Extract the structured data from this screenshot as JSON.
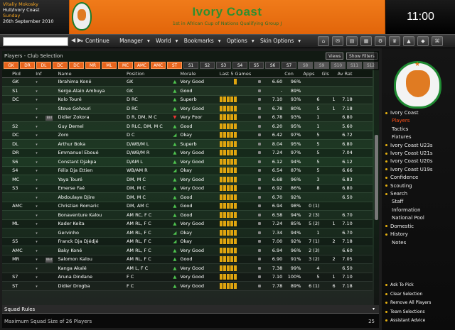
{
  "manager": {
    "name": "Vitaliy Mokosky",
    "club_line": "Hull/Ivory Coast",
    "day": "Sunday",
    "date": "26th September 2010"
  },
  "banner": {
    "title": "Ivory Coast",
    "subtitle": "1st in African Cup of Nations Qualifying Group J"
  },
  "clock": "11:00",
  "menu": {
    "continue": "Continue",
    "items": [
      "Manager",
      "World",
      "Bookmarks",
      "Options",
      "Skin Options"
    ]
  },
  "panel": {
    "title": "Players - Club Selection",
    "views_label": "Views",
    "show_filters_label": "Show Filters"
  },
  "filters": [
    "GK",
    "DR",
    "DL",
    "DC",
    "DC",
    "MR",
    "ML",
    "MC",
    "AMC",
    "AMC",
    "ST",
    "S1",
    "S2",
    "S3",
    "S4",
    "S5",
    "S6",
    "S7",
    "S8",
    "S9",
    "S10",
    "S11",
    "S12"
  ],
  "columns": [
    "Pkd",
    "Inf",
    "Name",
    "Position",
    "Morale",
    "Last 5 Games",
    "Con",
    "Apps",
    "Gls",
    "Av Rat"
  ],
  "players": [
    {
      "pkd": "GK",
      "inf": "",
      "name": "Ibrahima Koné",
      "pos": "GK",
      "morale": "Very Good",
      "mor": "up",
      "form": [
        0,
        0,
        0,
        0,
        1
      ],
      "rat": "6.60",
      "con": "96%",
      "apps": "",
      "gls": "",
      "av": ""
    },
    {
      "pkd": "S1",
      "inf": "",
      "name": "Serge-Alain Ambuya",
      "pos": "GK",
      "morale": "Good",
      "mor": "up",
      "form": [
        0,
        0,
        0,
        0,
        0
      ],
      "rat": "-",
      "con": "89%",
      "apps": "",
      "gls": "",
      "av": ""
    },
    {
      "pkd": "DC",
      "inf": "",
      "name": "Kolo Touré",
      "pos": "D RC",
      "morale": "Superb",
      "mor": "up",
      "form": [
        1,
        1,
        1,
        1,
        1
      ],
      "rat": "7.10",
      "con": "93%",
      "apps": "6",
      "gls": "1",
      "av": "7.18"
    },
    {
      "pkd": "",
      "inf": "",
      "name": "Steve Gohouri",
      "pos": "D RC",
      "morale": "Very Good",
      "mor": "up",
      "form": [
        1,
        1,
        1,
        1,
        1
      ],
      "rat": "6.78",
      "con": "80%",
      "apps": "5",
      "gls": "1",
      "av": "7.18"
    },
    {
      "pkd": "",
      "inf": "Bld",
      "name": "Didier Zokora",
      "pos": "D R, DM, M C",
      "morale": "Very Poor",
      "mor": "dn",
      "form": [
        1,
        1,
        1,
        1,
        1
      ],
      "rat": "6.78",
      "con": "93%",
      "apps": "1",
      "gls": "",
      "av": "6.80"
    },
    {
      "pkd": "S2",
      "inf": "",
      "name": "Guy Demel",
      "pos": "D RLC, DM, M C",
      "morale": "Good",
      "mor": "up",
      "form": [
        1,
        1,
        1,
        1,
        1
      ],
      "rat": "6.20",
      "con": "95%",
      "apps": "1",
      "gls": "",
      "av": "5.60"
    },
    {
      "pkd": "DC",
      "inf": "",
      "name": "Zoro",
      "pos": "D C",
      "morale": "Okay",
      "mor": "sd",
      "form": [
        1,
        1,
        1,
        1,
        1
      ],
      "rat": "6.42",
      "con": "97%",
      "apps": "5",
      "gls": "",
      "av": "6.72"
    },
    {
      "pkd": "DL",
      "inf": "",
      "name": "Arthur Boka",
      "pos": "D/WB/M L",
      "morale": "Superb",
      "mor": "up",
      "form": [
        1,
        1,
        1,
        1,
        1
      ],
      "rat": "8.04",
      "con": "95%",
      "apps": "5",
      "gls": "",
      "av": "6.80"
    },
    {
      "pkd": "DR",
      "inf": "",
      "name": "Emmanuel Eboué",
      "pos": "D/WB/M R",
      "morale": "Very Good",
      "mor": "up",
      "form": [
        1,
        1,
        1,
        1,
        1
      ],
      "rat": "7.24",
      "con": "97%",
      "apps": "5",
      "gls": "",
      "av": "7.04"
    },
    {
      "pkd": "S6",
      "inf": "",
      "name": "Constant Djakpa",
      "pos": "D/AM L",
      "morale": "Very Good",
      "mor": "up",
      "form": [
        1,
        1,
        1,
        1,
        1
      ],
      "rat": "6.12",
      "con": "94%",
      "apps": "5",
      "gls": "",
      "av": "6.12"
    },
    {
      "pkd": "S4",
      "inf": "",
      "name": "Félix Dja Ettien",
      "pos": "WB/AM R",
      "morale": "Okay",
      "mor": "sd",
      "form": [
        1,
        1,
        1,
        1,
        1
      ],
      "rat": "6.54",
      "con": "87%",
      "apps": "5",
      "gls": "",
      "av": "6.66"
    },
    {
      "pkd": "MC",
      "inf": "",
      "name": "Yaya Touré",
      "pos": "DM, M C",
      "morale": "Very Good",
      "mor": "up",
      "form": [
        1,
        1,
        1,
        1,
        1
      ],
      "rat": "6.68",
      "con": "96%",
      "apps": "3",
      "gls": "",
      "av": "6.83"
    },
    {
      "pkd": "S3",
      "inf": "",
      "name": "Emerse Faé",
      "pos": "DM, M C",
      "morale": "Very Good",
      "mor": "up",
      "form": [
        1,
        1,
        1,
        1,
        1
      ],
      "rat": "6.92",
      "con": "86%",
      "apps": "8",
      "gls": "",
      "av": "6.80"
    },
    {
      "pkd": "",
      "inf": "",
      "name": "Abdoulaye Djire",
      "pos": "DM, M C",
      "morale": "Good",
      "mor": "up",
      "form": [
        1,
        1,
        1,
        1,
        1
      ],
      "rat": "6.70",
      "con": "92%",
      "apps": "",
      "gls": "",
      "av": "6.50"
    },
    {
      "pkd": "AMC",
      "inf": "",
      "name": "Christian Romaric",
      "pos": "DM, AM C",
      "morale": "Good",
      "mor": "up",
      "form": [
        1,
        1,
        1,
        1,
        1
      ],
      "rat": "6.94",
      "con": "98%",
      "apps": "0 (1)",
      "gls": "",
      "av": ""
    },
    {
      "pkd": "",
      "inf": "",
      "name": "Bonaventure Kalou",
      "pos": "AM RC, F C",
      "morale": "Good",
      "mor": "up",
      "form": [
        1,
        1,
        1,
        1,
        1
      ],
      "rat": "6.58",
      "con": "94%",
      "apps": "2 (3)",
      "gls": "",
      "av": "6.70"
    },
    {
      "pkd": "ML",
      "inf": "",
      "name": "Kader Keita",
      "pos": "AM RL, F C",
      "morale": "Very Good",
      "mor": "up",
      "form": [
        1,
        1,
        1,
        1,
        1
      ],
      "rat": "7.24",
      "con": "85%",
      "apps": "5 (2)",
      "gls": "1",
      "av": "7.10"
    },
    {
      "pkd": "",
      "inf": "",
      "name": "Gervinho",
      "pos": "AM RL, F C",
      "morale": "Okay",
      "mor": "sd",
      "form": [
        1,
        1,
        1,
        1,
        1
      ],
      "rat": "7.34",
      "con": "94%",
      "apps": "1",
      "gls": "",
      "av": "6.70"
    },
    {
      "pkd": "S5",
      "inf": "",
      "name": "Franck Dja Djédjé",
      "pos": "AM RL, F C",
      "morale": "Okay",
      "mor": "sd",
      "form": [
        1,
        1,
        1,
        1,
        1
      ],
      "rat": "7.00",
      "con": "92%",
      "apps": "7 (1)",
      "gls": "2",
      "av": "7.18"
    },
    {
      "pkd": "AMC",
      "inf": "",
      "name": "Baky Koné",
      "pos": "AM RL, F C",
      "morale": "Very Good",
      "mor": "up",
      "form": [
        1,
        1,
        1,
        1,
        1
      ],
      "rat": "6.94",
      "con": "96%",
      "apps": "2 (3)",
      "gls": "",
      "av": "6.60"
    },
    {
      "pkd": "MR",
      "inf": "Wnt",
      "name": "Salomon Kalou",
      "pos": "AM RL, F C",
      "morale": "Good",
      "mor": "up",
      "form": [
        1,
        1,
        1,
        1,
        1
      ],
      "rat": "6.90",
      "con": "91%",
      "apps": "3 (2)",
      "gls": "2",
      "av": "7.05"
    },
    {
      "pkd": "",
      "inf": "",
      "name": "Kanga Akalé",
      "pos": "AM L, F C",
      "morale": "Very Good",
      "mor": "up",
      "form": [
        1,
        1,
        1,
        1,
        1
      ],
      "rat": "7.38",
      "con": "99%",
      "apps": "4",
      "gls": "",
      "av": "6.50"
    },
    {
      "pkd": "S7",
      "inf": "",
      "name": "Aruna Dindane",
      "pos": "F C",
      "morale": "Very Good",
      "mor": "up",
      "form": [
        1,
        1,
        1,
        1,
        1
      ],
      "rat": "7.10",
      "con": "100%",
      "apps": "5",
      "gls": "1",
      "av": "7.10"
    },
    {
      "pkd": "ST",
      "inf": "",
      "name": "Didier Drogba",
      "pos": "F C",
      "morale": "Very Good",
      "mor": "up",
      "form": [
        1,
        1,
        1,
        1,
        1
      ],
      "rat": "7.78",
      "con": "89%",
      "apps": "6 (1)",
      "gls": "6",
      "av": "7.18"
    }
  ],
  "squad": {
    "header": "Squad Rules",
    "rule": "Maximum Squad Size of 26 Players",
    "count": "25"
  },
  "sidebar": {
    "nav": [
      {
        "label": "Ivory Coast",
        "type": "b"
      },
      {
        "label": "Players",
        "type": "s act"
      },
      {
        "label": "Tactics",
        "type": "s"
      },
      {
        "label": "Fixtures",
        "type": "s"
      },
      {
        "label": "Ivory Coast U23s",
        "type": "b"
      },
      {
        "label": "Ivory Coast U21s",
        "type": "b"
      },
      {
        "label": "Ivory Coast U20s",
        "type": "b"
      },
      {
        "label": "Ivory Coast U19s",
        "type": "b"
      },
      {
        "label": "Confidence",
        "type": "b"
      },
      {
        "label": "Scouting",
        "type": "b"
      },
      {
        "label": "Search",
        "type": "b"
      },
      {
        "label": "Staff",
        "type": "s"
      },
      {
        "label": "Information",
        "type": "s"
      },
      {
        "label": "National Pool",
        "type": "s"
      },
      {
        "label": "Domestic",
        "type": "b"
      },
      {
        "label": "History",
        "type": "b"
      },
      {
        "label": "Notes",
        "type": "s"
      }
    ],
    "actions": [
      "Ask To Pick",
      "Clear Selection",
      "Remove All Players",
      "Team Selections",
      "Assistant Advice"
    ]
  },
  "colors": {
    "accent": "#e8641c",
    "banner_text": "#2f8f2f",
    "active_nav": "#ff4e17"
  }
}
